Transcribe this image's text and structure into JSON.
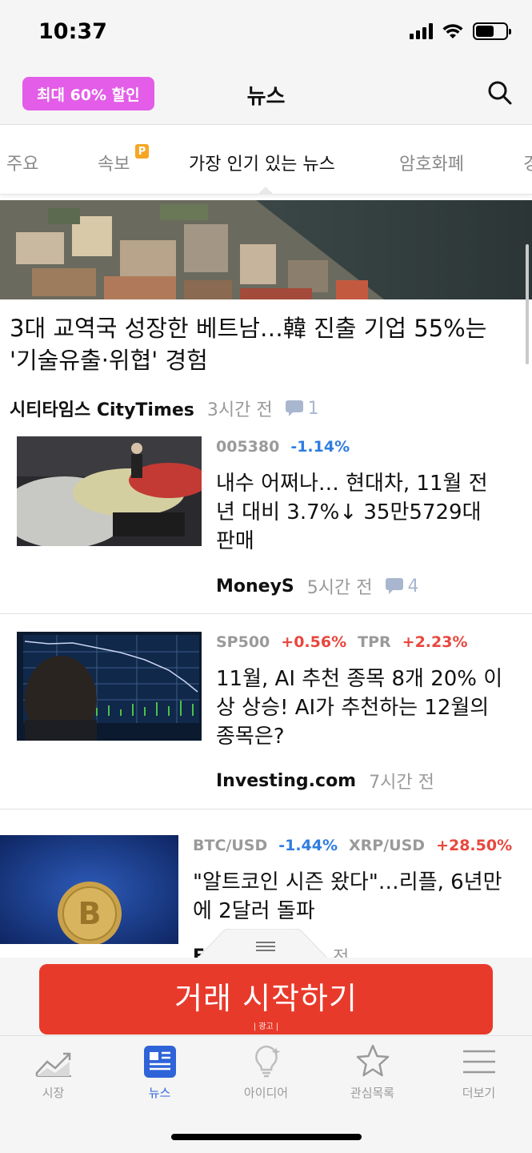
{
  "status_bar": {
    "time": "10:37"
  },
  "header": {
    "promo": "최대 60% 할인",
    "title": "뉴스"
  },
  "tabs": [
    {
      "label": "주요"
    },
    {
      "label": "속보",
      "badge": "P"
    },
    {
      "label": "가장 인기 있는 뉴스",
      "active": true
    },
    {
      "label": "암호화폐"
    },
    {
      "label": "경"
    }
  ],
  "hero": {
    "title": "3대 교역국 성장한 베트남…韓 진출 기업 55%는 '기술유출·위협' 경험",
    "source": "시티타임스 CityTimes",
    "time": "3시간 전",
    "comments": "1"
  },
  "articles": [
    {
      "tickers": [
        {
          "symbol": "005380",
          "change": "-1.14%"
        }
      ],
      "title": "내수 어쩌나… 현대차, 11월 전년 대비 3.7%↓ 35만5729대 판매",
      "source": "MoneyS",
      "time": "5시간 전",
      "comments": "4"
    },
    {
      "tickers": [
        {
          "symbol": "SP500",
          "change": "+0.56%"
        },
        {
          "symbol": "TPR",
          "change": "+2.23%"
        }
      ],
      "title": "11월, AI 추천 종목 8개 20% 이상 상승! AI가 추천하는 12월의 종목은?",
      "source": "Investing.com",
      "time": "7시간 전"
    },
    {
      "tickers": [
        {
          "symbol": "BTC/USD",
          "change": "-1.44%"
        },
        {
          "symbol": "XRP/USD",
          "change": "+28.50%"
        }
      ],
      "title": "\"알트코인 시즌 왔다\"…리플, 6년만에 2달러 돌파",
      "source": "E",
      "time": "전"
    }
  ],
  "cta": {
    "label": "거래 시작하기",
    "ad": "| 광고 |"
  },
  "bottom_nav": [
    {
      "label": "시장",
      "icon": "chart-line-icon"
    },
    {
      "label": "뉴스",
      "icon": "newspaper-icon",
      "active": true
    },
    {
      "label": "아이디어",
      "icon": "lightbulb-icon"
    },
    {
      "label": "관심목록",
      "icon": "star-icon"
    },
    {
      "label": "더보기",
      "icon": "menu-icon"
    }
  ],
  "colors": {
    "promo": "#e35de8",
    "cta": "#e83a2b",
    "positive": "#e8473d",
    "negative": "#2f7de1",
    "nav_active": "#2f63d8"
  }
}
